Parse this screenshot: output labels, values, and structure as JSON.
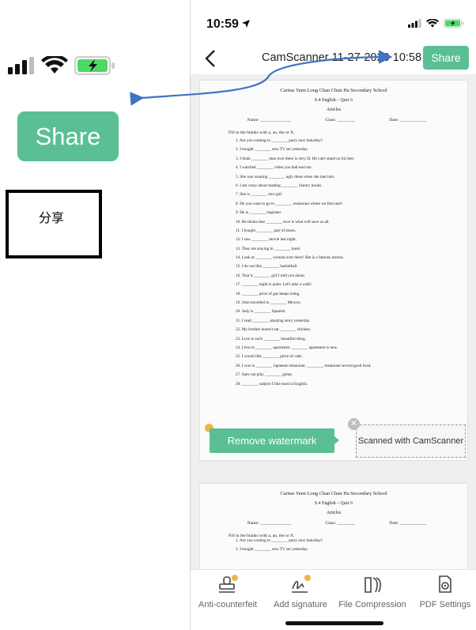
{
  "callout": {
    "share_label": "Share",
    "annotation": "分享"
  },
  "status": {
    "time": "10:59"
  },
  "nav": {
    "title": "CamScanner 11-27-2020 10:58",
    "share_label": "Share"
  },
  "document": {
    "school": "Caritas Yuen Long Chan Chun Ha Secondary School",
    "subtitle": "S.4 English – Quiz 6",
    "section": "Articles",
    "name_label": "Name: ______________",
    "class_label": "Class: ________",
    "date_label": "Date: ____________",
    "instruction": "Fill in the blanks with a, an, the or X.",
    "questions": [
      "1.  Are you coming to ________ party next Saturday?",
      "2.  I bought ________ new TV set yesterday.",
      "3.  I think ________ man over there is very ill. He can't stand on his feet.",
      "4.  I watched ________ video you had sent me.",
      "5.  She was wearing ________ ugly dress when she met him.",
      "6.  I am crazy about reading ________ history books.",
      "7.  She is ________ nice girl.",
      "8.  Do you want to go to ________ restaurant where we first met?",
      "9.  He is ________ engineer.",
      "10.  He thinks that ________ love is what will save us all.",
      "11.  I bought ________ pair of shoes.",
      "12.  I saw ________ movie last night.",
      "13.  They are staying in ________ hotel.",
      "14.  Look at ________ woman over there! She is a famous actress.",
      "15.  I do not like ________ basketball.",
      "16.  That is ________ girl I told you about.",
      "17.  ________ night is quiet. Let's take a walk!",
      "18.  ________ price of gas keeps rising.",
      "19.  John travelled to ________ Mexico.",
      "20.  Judy is ________ Spanish.",
      "21.  I read ________ amazing story yesterday.",
      "22.  My brother doesn't eat ________ chicken.",
      "23.  Love is such ________ beautiful thing.",
      "24.  I live in ________ apartment. ________ apartment is new.",
      "25.  I would like ________ piece of cake.",
      "26.  I was in ________ Japanese restaurant. ________ restaurant served good food.",
      "27.  Sam can play ________ guitar.",
      "28.  ________ subject I like most is English."
    ],
    "page2_questions": [
      "1.  Are you coming to ________ party next Saturday?",
      "2.  I bought ________ new TV set yesterday."
    ]
  },
  "watermark": {
    "remove_label": "Remove watermark",
    "text": "Scanned with CamScanner",
    "close_glyph": "✕"
  },
  "toolbar": {
    "items": [
      {
        "label": "Anti-counterfeit",
        "icon": "stamp-icon"
      },
      {
        "label": "Add signature",
        "icon": "signature-icon"
      },
      {
        "label": "File Compression",
        "icon": "compress-icon"
      },
      {
        "label": "PDF Settings",
        "icon": "pdf-settings-icon"
      }
    ]
  },
  "colors": {
    "accent": "#5bbf94",
    "arrow": "#3f73c6",
    "crown": "#f0b54a"
  }
}
